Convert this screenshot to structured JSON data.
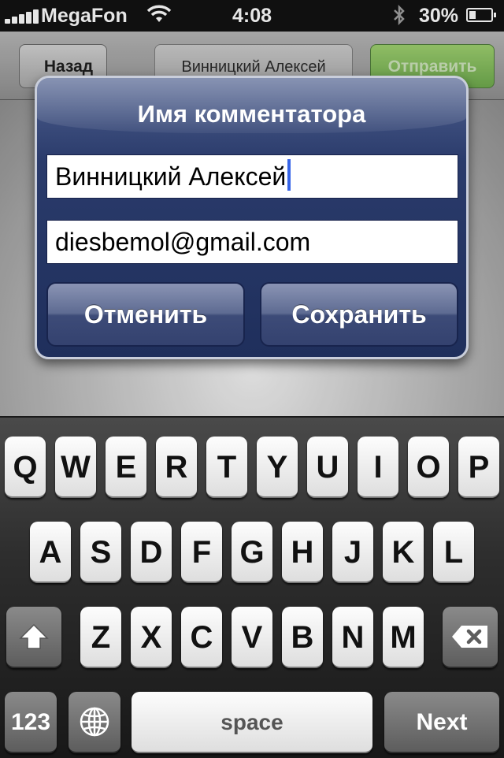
{
  "status_bar": {
    "carrier": "MegaFon",
    "time": "4:08",
    "battery": "30%",
    "battery_level": 0.3
  },
  "nav_bar": {
    "back_label": "Назад",
    "title": "Винницкий Алексей",
    "send_label": "Отправить"
  },
  "dialog": {
    "title": "Имя комментатора",
    "name_value": "Винницкий Алексей",
    "email_value": "diesbemol@gmail.com",
    "cancel_label": "Отменить",
    "save_label": "Сохранить"
  },
  "keyboard": {
    "row1": [
      "Q",
      "W",
      "E",
      "R",
      "T",
      "Y",
      "U",
      "I",
      "O",
      "P"
    ],
    "row2": [
      "A",
      "S",
      "D",
      "F",
      "G",
      "H",
      "J",
      "K",
      "L"
    ],
    "row3": [
      "Z",
      "X",
      "C",
      "V",
      "B",
      "N",
      "M"
    ],
    "numbers_label": "123",
    "space_label": "space",
    "next_label": "Next",
    "icons": {
      "shift": "shift-icon",
      "delete": "delete-icon",
      "globe": "globe-icon"
    }
  }
}
